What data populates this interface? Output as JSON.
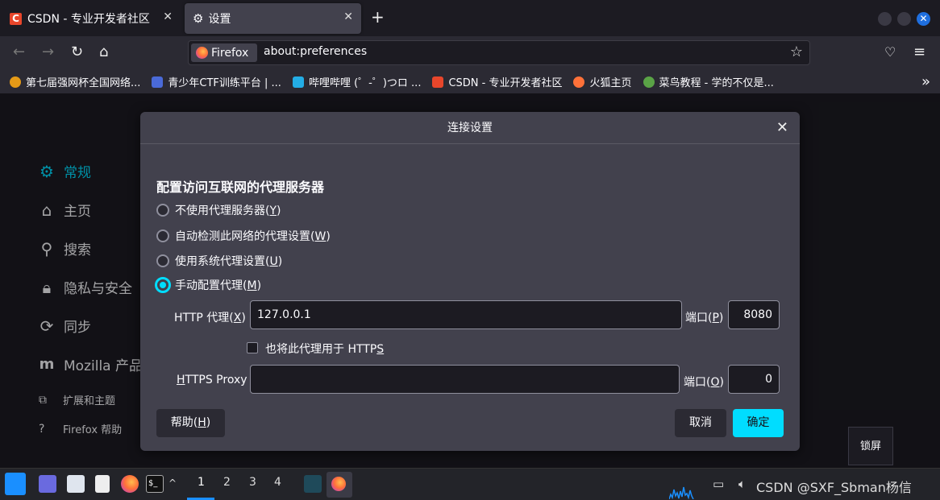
{
  "tabs": [
    {
      "title": "CSDN - 专业开发者社区",
      "icon": "csdn-icon"
    },
    {
      "title": "设置",
      "icon": "gear-icon"
    }
  ],
  "url": {
    "identity": "Firefox",
    "address": "about:preferences"
  },
  "bookmarks": [
    {
      "label": "第七届强网杯全国网络...",
      "color": "#e59a17"
    },
    {
      "label": "青少年CTF训练平台 | ...",
      "color": "#4a6ad8"
    },
    {
      "label": "哔哩哔哩 (゜-゜)つロ ...",
      "color": "#23ade5"
    },
    {
      "label": "CSDN - 专业开发者社区",
      "color": "#e8462b"
    },
    {
      "label": "火狐主页",
      "color": "#ff7139"
    },
    {
      "label": "菜鸟教程 - 学的不仅是...",
      "color": "#5aa346"
    }
  ],
  "sidebar": {
    "items": [
      "常规",
      "主页",
      "搜索",
      "隐私与安全",
      "同步",
      "Mozilla 产品"
    ],
    "footer": [
      "扩展和主题",
      "Firefox 帮助"
    ]
  },
  "dialog": {
    "title": "连接设置",
    "heading": "配置访问互联网的代理服务器",
    "options": [
      {
        "text": "不使用代理服务器(",
        "key": "Y",
        "end": ")"
      },
      {
        "text": "自动检测此网络的代理设置(",
        "key": "W",
        "end": ")"
      },
      {
        "text": "使用系统代理设置(",
        "key": "U",
        "end": ")"
      },
      {
        "text": "手动配置代理(",
        "key": "M",
        "end": ")"
      }
    ],
    "selected": 3,
    "http_label": "HTTP 代理(",
    "http_key": "X",
    "http_value": "127.0.0.1",
    "http_port_label": "端口(",
    "http_port_key": "P",
    "http_port": "8080",
    "also_https": "也将此代理用于 HTTP",
    "also_https_key": "S",
    "https_label_key": "H",
    "https_label_rest": "TTPS Proxy",
    "https_value": "",
    "https_port_label": "端口(",
    "https_port_key": "O",
    "https_port": "0",
    "help_btn": "帮助(",
    "help_key": "H",
    "cancel_btn": "取消",
    "ok_btn": "确定"
  },
  "tooltip": "锁屏",
  "taskbar": {
    "workspaces": [
      "1",
      "2",
      "3",
      "4"
    ],
    "active_ws": "1",
    "watermark": "CSDN @SXF_Sbman杨信"
  }
}
